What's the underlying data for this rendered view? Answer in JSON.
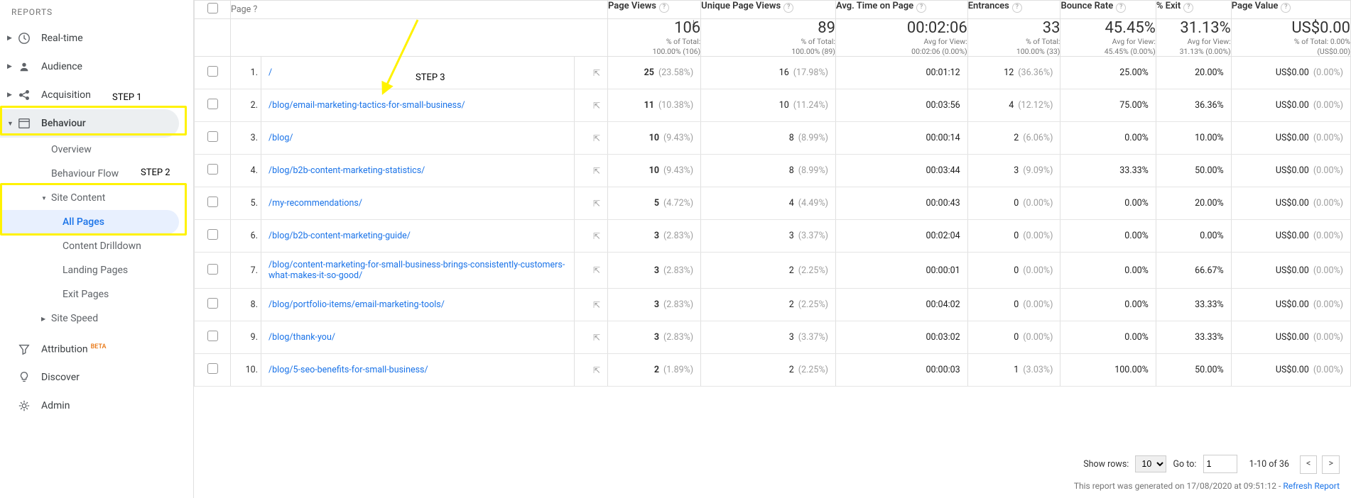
{
  "sidebar": {
    "section_title": "REPORTS",
    "items": [
      {
        "label": "Real-time",
        "icon": "clock"
      },
      {
        "label": "Audience",
        "icon": "person"
      },
      {
        "label": "Acquisition",
        "icon": "share"
      },
      {
        "label": "Behaviour",
        "icon": "browser"
      },
      {
        "label": "Attribution",
        "icon": "funnel",
        "beta": true
      },
      {
        "label": "Discover",
        "icon": "bulb"
      },
      {
        "label": "Admin",
        "icon": "gear"
      }
    ],
    "behaviour_sub": {
      "overview": "Overview",
      "flow": "Behaviour Flow",
      "site_content": "Site Content",
      "all_pages": "All Pages",
      "content_drilldown": "Content Drilldown",
      "landing_pages": "Landing Pages",
      "exit_pages": "Exit Pages",
      "site_speed": "Site Speed"
    },
    "beta_tag": "BETA"
  },
  "annotations": {
    "step1": "STEP 1",
    "step2": "STEP 2",
    "step3": "STEP 3"
  },
  "table": {
    "dimension_label": "Page",
    "columns": [
      "Page Views",
      "Unique Page Views",
      "Avg. Time on Page",
      "Entrances",
      "Bounce Rate",
      "% Exit",
      "Page Value"
    ],
    "summary": {
      "page_views": {
        "big": "106",
        "l1": "% of Total:",
        "l2": "100.00% (106)"
      },
      "unique": {
        "big": "89",
        "l1": "% of Total:",
        "l2": "100.00% (89)"
      },
      "avg_time": {
        "big": "00:02:06",
        "l1": "Avg for View:",
        "l2": "00:02:06 (0.00%)"
      },
      "entrances": {
        "big": "33",
        "l1": "% of Total:",
        "l2": "100.00% (33)"
      },
      "bounce": {
        "big": "45.45%",
        "l1": "Avg for View:",
        "l2": "45.45% (0.00%)"
      },
      "exit": {
        "big": "31.13%",
        "l1": "Avg for View:",
        "l2": "31.13% (0.00%)"
      },
      "value": {
        "big": "US$0.00",
        "l1": "% of Total: 0.00%",
        "l2": "(US$0.00)"
      }
    },
    "rows": [
      {
        "i": "1.",
        "page": "/",
        "pv": "25",
        "pvp": "(23.58%)",
        "upv": "16",
        "upvp": "(17.98%)",
        "avg": "00:01:12",
        "ent": "12",
        "entp": "(36.36%)",
        "br": "25.00%",
        "ex": "20.00%",
        "val": "US$0.00",
        "valp": "(0.00%)"
      },
      {
        "i": "2.",
        "page": "/blog/email-marketing-tactics-for-small-business/",
        "pv": "11",
        "pvp": "(10.38%)",
        "upv": "10",
        "upvp": "(11.24%)",
        "avg": "00:03:56",
        "ent": "4",
        "entp": "(12.12%)",
        "br": "75.00%",
        "ex": "36.36%",
        "val": "US$0.00",
        "valp": "(0.00%)"
      },
      {
        "i": "3.",
        "page": "/blog/",
        "pv": "10",
        "pvp": "(9.43%)",
        "upv": "8",
        "upvp": "(8.99%)",
        "avg": "00:00:14",
        "ent": "2",
        "entp": "(6.06%)",
        "br": "0.00%",
        "ex": "10.00%",
        "val": "US$0.00",
        "valp": "(0.00%)"
      },
      {
        "i": "4.",
        "page": "/blog/b2b-content-marketing-statistics/",
        "pv": "10",
        "pvp": "(9.43%)",
        "upv": "8",
        "upvp": "(8.99%)",
        "avg": "00:03:44",
        "ent": "3",
        "entp": "(9.09%)",
        "br": "33.33%",
        "ex": "50.00%",
        "val": "US$0.00",
        "valp": "(0.00%)"
      },
      {
        "i": "5.",
        "page": "/my-recommendations/",
        "pv": "5",
        "pvp": "(4.72%)",
        "upv": "4",
        "upvp": "(4.49%)",
        "avg": "00:00:43",
        "ent": "0",
        "entp": "(0.00%)",
        "br": "0.00%",
        "ex": "20.00%",
        "val": "US$0.00",
        "valp": "(0.00%)"
      },
      {
        "i": "6.",
        "page": "/blog/b2b-content-marketing-guide/",
        "pv": "3",
        "pvp": "(2.83%)",
        "upv": "3",
        "upvp": "(3.37%)",
        "avg": "00:02:04",
        "ent": "0",
        "entp": "(0.00%)",
        "br": "0.00%",
        "ex": "0.00%",
        "val": "US$0.00",
        "valp": "(0.00%)"
      },
      {
        "i": "7.",
        "page": "/blog/content-marketing-for-small-business-brings-consistently-customers-what-makes-it-so-good/",
        "pv": "3",
        "pvp": "(2.83%)",
        "upv": "2",
        "upvp": "(2.25%)",
        "avg": "00:00:01",
        "ent": "0",
        "entp": "(0.00%)",
        "br": "0.00%",
        "ex": "66.67%",
        "val": "US$0.00",
        "valp": "(0.00%)"
      },
      {
        "i": "8.",
        "page": "/blog/portfolio-items/email-marketing-tools/",
        "pv": "3",
        "pvp": "(2.83%)",
        "upv": "2",
        "upvp": "(2.25%)",
        "avg": "00:04:02",
        "ent": "0",
        "entp": "(0.00%)",
        "br": "0.00%",
        "ex": "33.33%",
        "val": "US$0.00",
        "valp": "(0.00%)"
      },
      {
        "i": "9.",
        "page": "/blog/thank-you/",
        "pv": "3",
        "pvp": "(2.83%)",
        "upv": "3",
        "upvp": "(3.37%)",
        "avg": "00:03:02",
        "ent": "0",
        "entp": "(0.00%)",
        "br": "0.00%",
        "ex": "33.33%",
        "val": "US$0.00",
        "valp": "(0.00%)"
      },
      {
        "i": "10.",
        "page": "/blog/5-seo-benefits-for-small-business/",
        "pv": "2",
        "pvp": "(1.89%)",
        "upv": "2",
        "upvp": "(2.25%)",
        "avg": "00:00:03",
        "ent": "1",
        "entp": "(3.03%)",
        "br": "100.00%",
        "ex": "50.00%",
        "val": "US$0.00",
        "valp": "(0.00%)"
      }
    ]
  },
  "footer": {
    "show_rows_label": "Show rows:",
    "show_rows_value": "10",
    "goto_label": "Go to:",
    "goto_value": "1",
    "range": "1-10 of 36",
    "generated_prefix": "This report was generated on ",
    "generated_date": "17/08/2020 at 09:51:12",
    "refresh": "Refresh Report"
  }
}
